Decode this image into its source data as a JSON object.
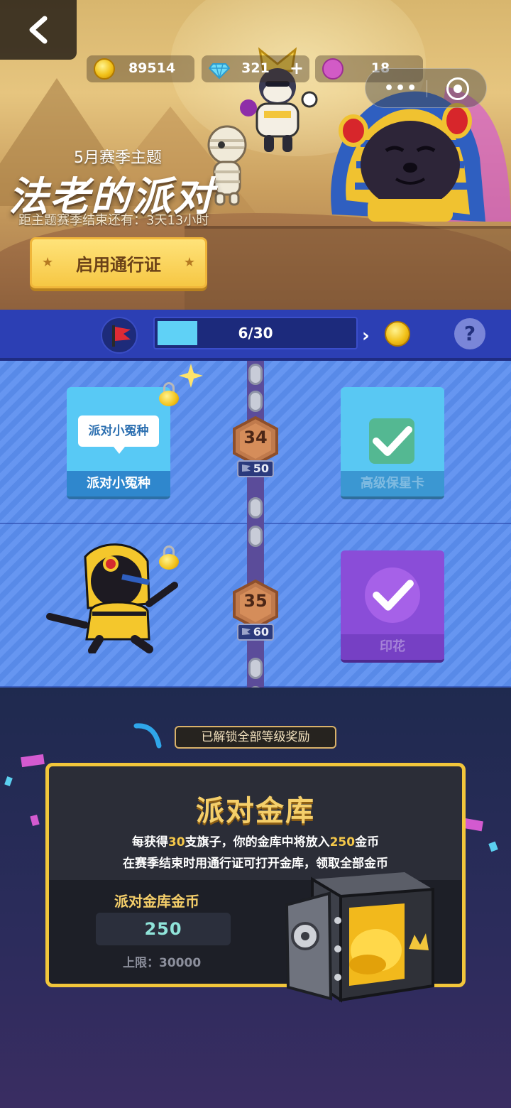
{
  "top_bar": {
    "back_icon": "chevron-left-icon",
    "currencies": [
      {
        "icon": "gold-coin-icon",
        "value": "89514"
      },
      {
        "icon": "diamond-icon",
        "value": "321",
        "has_plus": true
      },
      {
        "icon": "lotus-icon",
        "value": "18"
      }
    ],
    "capsule": {
      "more_icon": "more-dots-icon",
      "close_icon": "target-close-icon",
      "dots": "•••"
    }
  },
  "hero": {
    "subtitle": "5月赛季主题",
    "title": "法老的派对",
    "timer": "距主题赛季结束还有：3天13小时",
    "pass_button": "启用通行证"
  },
  "progress": {
    "level_text": "6/30",
    "fill_fraction": 0.2,
    "arrow": "›",
    "help": "?"
  },
  "rows": [
    {
      "level": "34",
      "flags": "50",
      "free_reward": {
        "bubble": "派对小冤种",
        "caption": "派对小冤种",
        "locked": true
      },
      "pass_reward": {
        "caption": "高级保星卡",
        "claimed": true
      }
    },
    {
      "level": "35",
      "flags": "60",
      "free_reward": {
        "caption": "",
        "locked": true
      },
      "pass_reward": {
        "caption": "印花",
        "claimed": true
      }
    }
  ],
  "vault": {
    "unlocked_label": "已解锁全部等级奖励",
    "title": "派对金库",
    "desc1_pre": "每获得",
    "desc1_num1": "30",
    "desc1_mid": "支旗子，你的金库中将放入",
    "desc1_num2": "250",
    "desc1_post": "金币",
    "desc2": "在赛季结束时用通行证可打开金库，领取全部金币",
    "coins_label": "派对金库金币",
    "coins_value": "250",
    "limit": "上限：30000"
  },
  "colors": {
    "accent_blue": "#2c3fb4",
    "row_blue": "#5b8ef0",
    "gold": "#f2c63b",
    "progress_fill": "#5fd1f6"
  }
}
